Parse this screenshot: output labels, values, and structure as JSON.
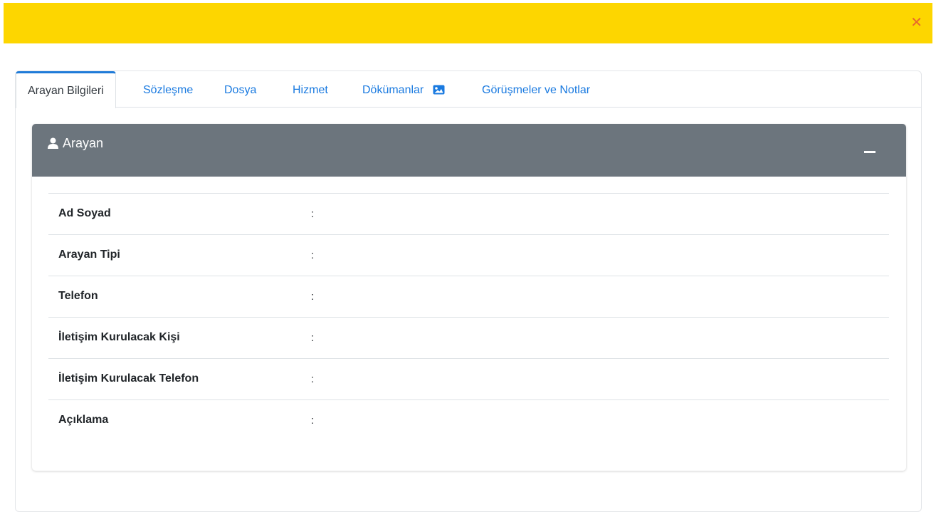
{
  "window": {
    "close_icon": "close-icon",
    "accent": "#fdd600",
    "close_color": "#e8672c"
  },
  "tabs": [
    {
      "label": "Arayan Bilgileri",
      "active": true
    },
    {
      "label": "Sözleşme",
      "active": false
    },
    {
      "label": "Dosya",
      "active": false
    },
    {
      "label": "Hizmet",
      "active": false
    },
    {
      "label": "Dökümanlar",
      "active": false,
      "icon": "image-icon"
    },
    {
      "label": "Görüşmeler ve Notlar",
      "active": false
    }
  ],
  "panel": {
    "title": "Arayan",
    "title_icon": "user-icon",
    "header_color": "#6c757d",
    "collapse_icon": "minus-icon"
  },
  "fields": [
    {
      "label": "Ad Soyad",
      "separator": ":",
      "value": ""
    },
    {
      "label": "Arayan Tipi",
      "separator": ":",
      "value": ""
    },
    {
      "label": "Telefon",
      "separator": ":",
      "value": ""
    },
    {
      "label": "İletişim Kurulacak Kişi",
      "separator": ":",
      "value": ""
    },
    {
      "label": "İletişim Kurulacak Telefon",
      "separator": ":",
      "value": ""
    },
    {
      "label": "Açıklama",
      "separator": ":",
      "value": ""
    }
  ]
}
